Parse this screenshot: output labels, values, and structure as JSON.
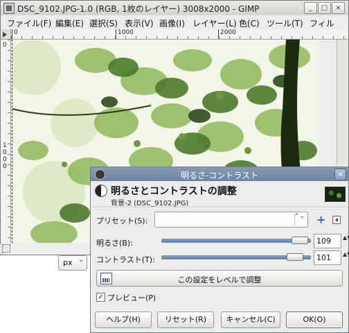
{
  "window": {
    "title": "DSC_9102.JPG-1.0 (RGB, 1枚のレイヤー) 3008x2000 - GIMP",
    "buttons": {
      "minimize": "_",
      "maximize": "□",
      "close": "×"
    }
  },
  "menubar": {
    "items": [
      "ファイル(F)",
      "編集(E)",
      "選択(S)",
      "表示(V)",
      "画像(I)",
      "レイヤー(L)",
      "色(C)",
      "ツール(T)",
      "フィル"
    ]
  },
  "rulers": {
    "h_labels": [
      "0",
      "1000",
      "2000"
    ],
    "v_labels": [
      "0",
      "1",
      "0",
      "0",
      "0"
    ]
  },
  "statusbar": {
    "unit": "px",
    "unit_arrow": "⌄"
  },
  "dialog": {
    "title": "明るさ-コントラスト",
    "close_glyph": "×",
    "header_title": "明るさとコントラストの調整",
    "header_subtitle": "背景-2 (DSC_9102.JPG)",
    "presets_label": "プリセット(S):",
    "presets_value": "",
    "presets_arrow": "⌃⌄",
    "add_glyph": "+",
    "brightness": {
      "label": "明るさ(B):",
      "value": "109",
      "level": 109,
      "min": -127,
      "max": 127
    },
    "contrast": {
      "label": "コントラスト(T):",
      "value": "101",
      "level": 101,
      "min": -127,
      "max": 127
    },
    "spin_arrows": "▲▼",
    "levels_button": "この設定をレベルで調整",
    "preview": {
      "label": "プレビュー(P)",
      "checked": true,
      "check_glyph": "✓"
    },
    "buttons": {
      "help": "ヘルプ(H)",
      "reset": "リセット(R)",
      "cancel": "キャンセル(C)",
      "ok": "OK(O)"
    }
  },
  "colors": {
    "dialog_title": "#7a8ea8",
    "slider_fill": "#5a86c6",
    "foliage_dark": "#2e4a1e",
    "foliage_light": "#8fb85a"
  }
}
